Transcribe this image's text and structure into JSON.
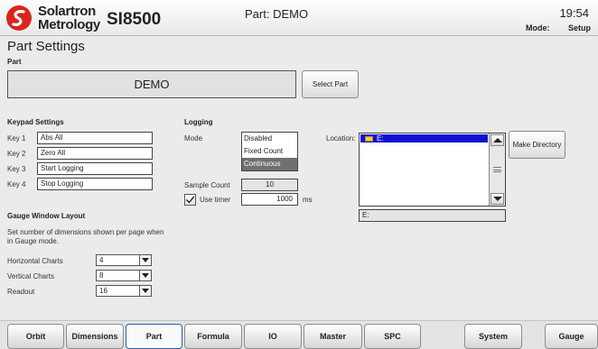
{
  "header": {
    "brand_line1": "Solartron",
    "brand_line2": "Metrology",
    "model": "SI8500",
    "part_title": "Part: DEMO",
    "time": "19:54",
    "mode_label": "Mode:",
    "mode_value": "Setup",
    "logo_color": "#d9261c"
  },
  "page": {
    "title": "Part Settings"
  },
  "part": {
    "section_label": "Part",
    "name": "DEMO",
    "select_button": "Select Part"
  },
  "keypad": {
    "section_label": "Keypad Settings",
    "keys": [
      {
        "label": "Key 1",
        "value": "Abs All"
      },
      {
        "label": "Key 2",
        "value": "Zero All"
      },
      {
        "label": "Key 3",
        "value": "Start Logging"
      },
      {
        "label": "Key 4",
        "value": "Stop Logging"
      }
    ]
  },
  "gauge": {
    "section_label": "Gauge Window Layout",
    "description": "Set number of dimensions shown per page when in Gauge mode.",
    "rows": [
      {
        "label": "Horizontal Charts",
        "value": "4"
      },
      {
        "label": "Vertical Charts",
        "value": "8"
      },
      {
        "label": "Readout",
        "value": "16"
      }
    ]
  },
  "logging": {
    "section_label": "Logging",
    "mode_label": "Mode",
    "modes": [
      "Disabled",
      "Fixed Count",
      "Continuous"
    ],
    "selected_mode": "Continuous",
    "sample_count_label": "Sample Count",
    "sample_count": "10",
    "use_timer_label": "Use timer",
    "use_timer_checked": true,
    "timer_value": "1000",
    "timer_unit": "ms"
  },
  "location": {
    "label": "Location:",
    "selected_dir": "E:",
    "path": "E:",
    "make_dir_button": "Make Directory"
  },
  "tabs": [
    {
      "label": "Orbit"
    },
    {
      "label": "Dimensions"
    },
    {
      "label": "Part",
      "active": true
    },
    {
      "label": "Formula"
    },
    {
      "label": "IO"
    },
    {
      "label": "Master"
    },
    {
      "label": "SPC"
    },
    {
      "label": "System"
    },
    {
      "label": "Gauge"
    }
  ]
}
